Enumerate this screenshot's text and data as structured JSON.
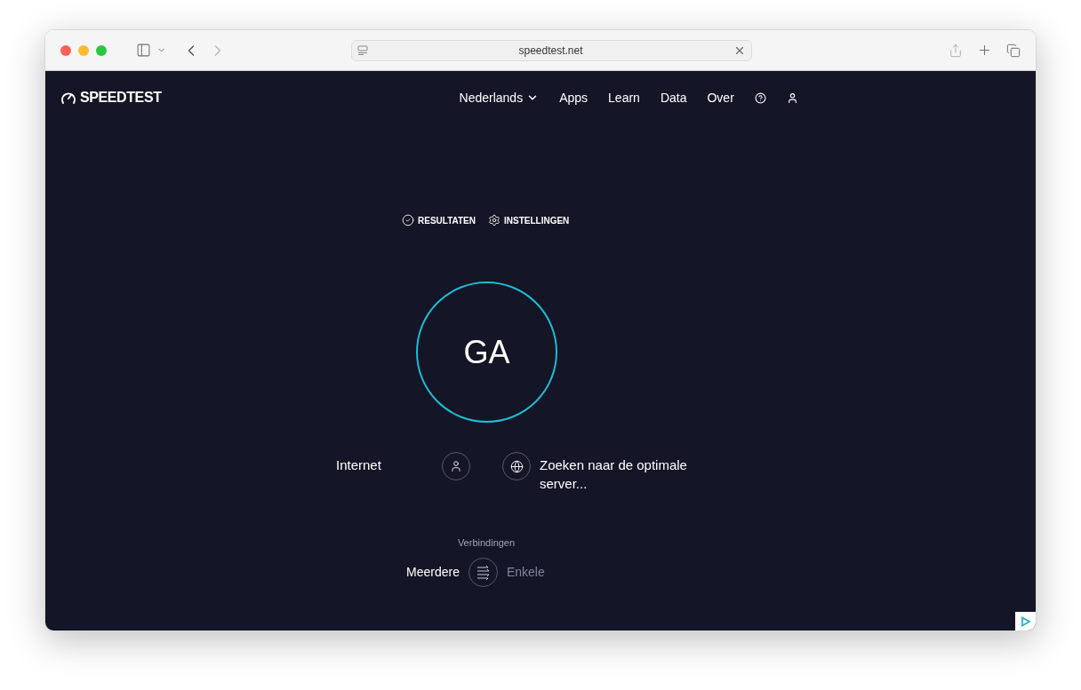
{
  "browser": {
    "url": "speedtest.net"
  },
  "site": {
    "logo": "SPEEDTEST",
    "nav": [
      {
        "label": "Nederlands",
        "kind": "dropdown"
      },
      {
        "label": "Apps",
        "kind": "link"
      },
      {
        "label": "Learn",
        "kind": "link"
      },
      {
        "label": "Data",
        "kind": "link"
      },
      {
        "label": "Over",
        "kind": "link"
      }
    ]
  },
  "tabs": [
    {
      "label": "RESULTATEN",
      "kind": "results"
    },
    {
      "label": "INSTELLINGEN",
      "kind": "settings"
    }
  ],
  "start_button": "GA",
  "provider": "Internet",
  "server": "Zoeken naar de optimale server...",
  "connections": {
    "title": "Verbindingen",
    "options": [
      {
        "label": "Meerdere",
        "selected": true
      },
      {
        "label": "Enkele",
        "selected": false
      }
    ]
  }
}
